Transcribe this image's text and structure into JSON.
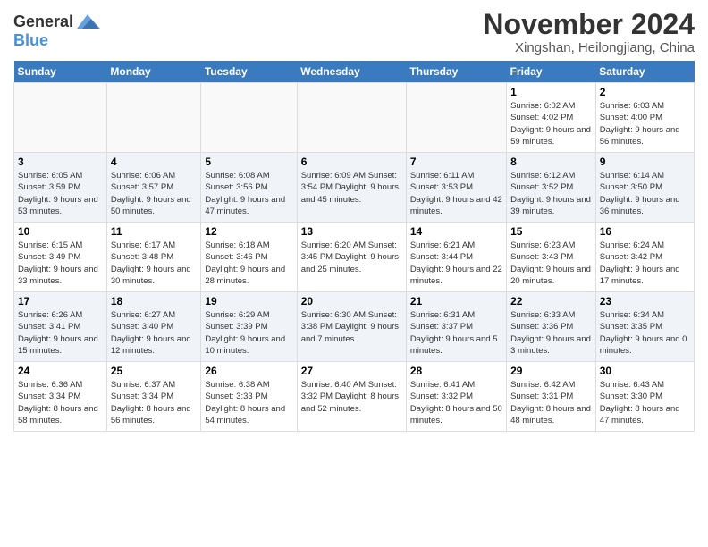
{
  "header": {
    "logo_line1": "General",
    "logo_line2": "Blue",
    "title": "November 2024",
    "subtitle": "Xingshan, Heilongjiang, China"
  },
  "days_of_week": [
    "Sunday",
    "Monday",
    "Tuesday",
    "Wednesday",
    "Thursday",
    "Friday",
    "Saturday"
  ],
  "weeks": [
    {
      "days": [
        {
          "num": "",
          "info": ""
        },
        {
          "num": "",
          "info": ""
        },
        {
          "num": "",
          "info": ""
        },
        {
          "num": "",
          "info": ""
        },
        {
          "num": "",
          "info": ""
        },
        {
          "num": "1",
          "info": "Sunrise: 6:02 AM\nSunset: 4:02 PM\nDaylight: 9 hours and 59 minutes."
        },
        {
          "num": "2",
          "info": "Sunrise: 6:03 AM\nSunset: 4:00 PM\nDaylight: 9 hours and 56 minutes."
        }
      ]
    },
    {
      "days": [
        {
          "num": "3",
          "info": "Sunrise: 6:05 AM\nSunset: 3:59 PM\nDaylight: 9 hours and 53 minutes."
        },
        {
          "num": "4",
          "info": "Sunrise: 6:06 AM\nSunset: 3:57 PM\nDaylight: 9 hours and 50 minutes."
        },
        {
          "num": "5",
          "info": "Sunrise: 6:08 AM\nSunset: 3:56 PM\nDaylight: 9 hours and 47 minutes."
        },
        {
          "num": "6",
          "info": "Sunrise: 6:09 AM\nSunset: 3:54 PM\nDaylight: 9 hours and 45 minutes."
        },
        {
          "num": "7",
          "info": "Sunrise: 6:11 AM\nSunset: 3:53 PM\nDaylight: 9 hours and 42 minutes."
        },
        {
          "num": "8",
          "info": "Sunrise: 6:12 AM\nSunset: 3:52 PM\nDaylight: 9 hours and 39 minutes."
        },
        {
          "num": "9",
          "info": "Sunrise: 6:14 AM\nSunset: 3:50 PM\nDaylight: 9 hours and 36 minutes."
        }
      ]
    },
    {
      "days": [
        {
          "num": "10",
          "info": "Sunrise: 6:15 AM\nSunset: 3:49 PM\nDaylight: 9 hours and 33 minutes."
        },
        {
          "num": "11",
          "info": "Sunrise: 6:17 AM\nSunset: 3:48 PM\nDaylight: 9 hours and 30 minutes."
        },
        {
          "num": "12",
          "info": "Sunrise: 6:18 AM\nSunset: 3:46 PM\nDaylight: 9 hours and 28 minutes."
        },
        {
          "num": "13",
          "info": "Sunrise: 6:20 AM\nSunset: 3:45 PM\nDaylight: 9 hours and 25 minutes."
        },
        {
          "num": "14",
          "info": "Sunrise: 6:21 AM\nSunset: 3:44 PM\nDaylight: 9 hours and 22 minutes."
        },
        {
          "num": "15",
          "info": "Sunrise: 6:23 AM\nSunset: 3:43 PM\nDaylight: 9 hours and 20 minutes."
        },
        {
          "num": "16",
          "info": "Sunrise: 6:24 AM\nSunset: 3:42 PM\nDaylight: 9 hours and 17 minutes."
        }
      ]
    },
    {
      "days": [
        {
          "num": "17",
          "info": "Sunrise: 6:26 AM\nSunset: 3:41 PM\nDaylight: 9 hours and 15 minutes."
        },
        {
          "num": "18",
          "info": "Sunrise: 6:27 AM\nSunset: 3:40 PM\nDaylight: 9 hours and 12 minutes."
        },
        {
          "num": "19",
          "info": "Sunrise: 6:29 AM\nSunset: 3:39 PM\nDaylight: 9 hours and 10 minutes."
        },
        {
          "num": "20",
          "info": "Sunrise: 6:30 AM\nSunset: 3:38 PM\nDaylight: 9 hours and 7 minutes."
        },
        {
          "num": "21",
          "info": "Sunrise: 6:31 AM\nSunset: 3:37 PM\nDaylight: 9 hours and 5 minutes."
        },
        {
          "num": "22",
          "info": "Sunrise: 6:33 AM\nSunset: 3:36 PM\nDaylight: 9 hours and 3 minutes."
        },
        {
          "num": "23",
          "info": "Sunrise: 6:34 AM\nSunset: 3:35 PM\nDaylight: 9 hours and 0 minutes."
        }
      ]
    },
    {
      "days": [
        {
          "num": "24",
          "info": "Sunrise: 6:36 AM\nSunset: 3:34 PM\nDaylight: 8 hours and 58 minutes."
        },
        {
          "num": "25",
          "info": "Sunrise: 6:37 AM\nSunset: 3:34 PM\nDaylight: 8 hours and 56 minutes."
        },
        {
          "num": "26",
          "info": "Sunrise: 6:38 AM\nSunset: 3:33 PM\nDaylight: 8 hours and 54 minutes."
        },
        {
          "num": "27",
          "info": "Sunrise: 6:40 AM\nSunset: 3:32 PM\nDaylight: 8 hours and 52 minutes."
        },
        {
          "num": "28",
          "info": "Sunrise: 6:41 AM\nSunset: 3:32 PM\nDaylight: 8 hours and 50 minutes."
        },
        {
          "num": "29",
          "info": "Sunrise: 6:42 AM\nSunset: 3:31 PM\nDaylight: 8 hours and 48 minutes."
        },
        {
          "num": "30",
          "info": "Sunrise: 6:43 AM\nSunset: 3:30 PM\nDaylight: 8 hours and 47 minutes."
        }
      ]
    }
  ]
}
